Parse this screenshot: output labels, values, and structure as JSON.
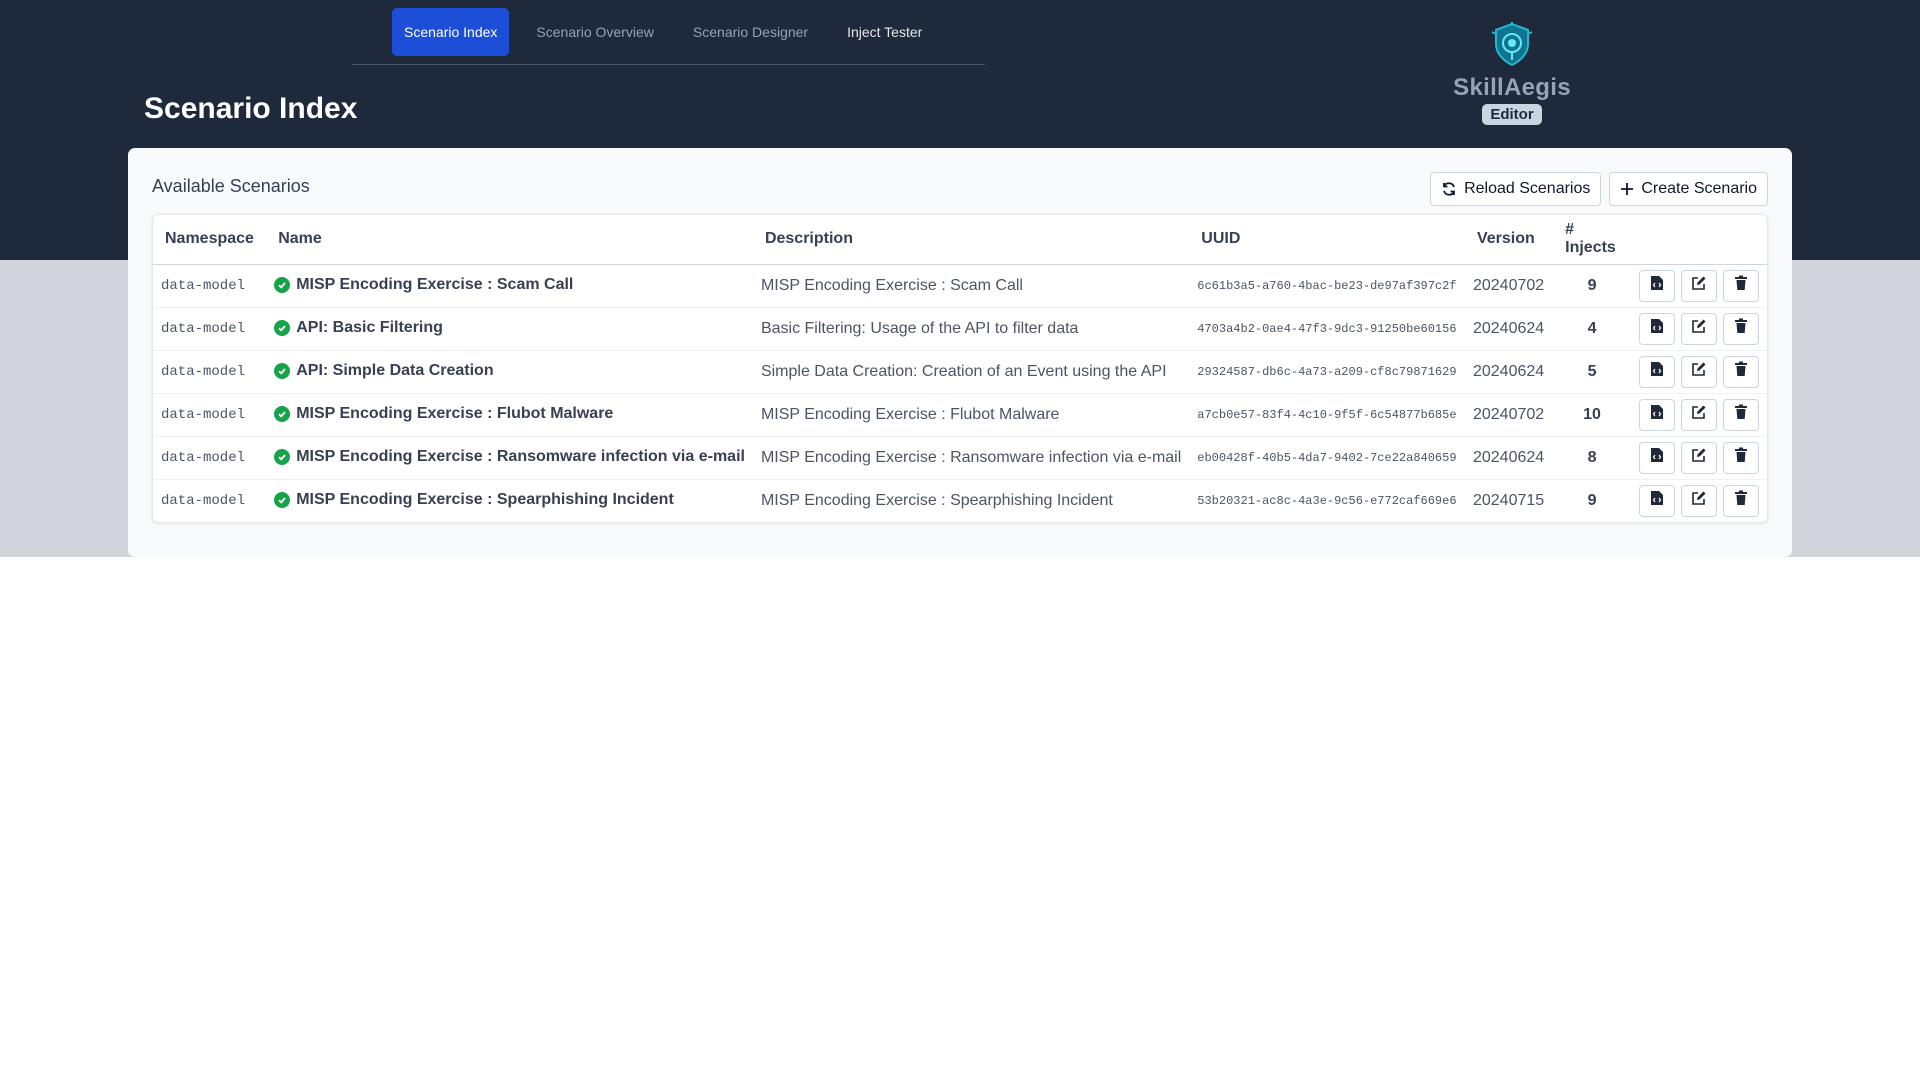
{
  "nav": {
    "tabs": [
      {
        "label": "Scenario Index",
        "active": true
      },
      {
        "label": "Scenario Overview",
        "active": false
      },
      {
        "label": "Scenario Designer",
        "active": false
      },
      {
        "label": "Inject Tester",
        "active": false
      }
    ]
  },
  "header": {
    "title": "Scenario Index"
  },
  "brand": {
    "name": "SkillAegis",
    "badge": "Editor",
    "logo_icon": "shield-eye-icon",
    "logo_color": "#22b8cf"
  },
  "card": {
    "title": "Available Scenarios",
    "reload_label": "Reload Scenarios",
    "create_label": "Create Scenario"
  },
  "table": {
    "columns": [
      "Namespace",
      "Name",
      "Description",
      "UUID",
      "Version",
      "# Injects"
    ],
    "rows": [
      {
        "namespace": "data-model",
        "name": "MISP Encoding Exercise : Scam Call",
        "description": "MISP Encoding Exercise : Scam Call",
        "uuid": "6c61b3a5-a760-4bac-be23-de97af397c2f",
        "version": "20240702",
        "injects": "9"
      },
      {
        "namespace": "data-model",
        "name": "API: Basic Filtering",
        "description": "Basic Filtering: Usage of the API to filter data",
        "uuid": "4703a4b2-0ae4-47f3-9dc3-91250be60156",
        "version": "20240624",
        "injects": "4"
      },
      {
        "namespace": "data-model",
        "name": "API: Simple Data Creation",
        "description": "Simple Data Creation: Creation of an Event using the API",
        "uuid": "29324587-db6c-4a73-a209-cf8c79871629",
        "version": "20240624",
        "injects": "5"
      },
      {
        "namespace": "data-model",
        "name": "MISP Encoding Exercise : Flubot Malware",
        "description": "MISP Encoding Exercise : Flubot Malware",
        "uuid": "a7cb0e57-83f4-4c10-9f5f-6c54877b685e",
        "version": "20240702",
        "injects": "10"
      },
      {
        "namespace": "data-model",
        "name": "MISP Encoding Exercise : Ransomware infection via e-mail",
        "description": "MISP Encoding Exercise : Ransomware infection via e-mail",
        "uuid": "eb00428f-40b5-4da7-9402-7ce22a840659",
        "version": "20240624",
        "injects": "8"
      },
      {
        "namespace": "data-model",
        "name": "MISP Encoding Exercise : Spearphishing Incident",
        "description": "MISP Encoding Exercise : Spearphishing Incident",
        "uuid": "53b20321-ac8c-4a3e-9c56-e772caf669e6",
        "version": "20240715",
        "injects": "9"
      }
    ],
    "row_status_icon": "check-circle-icon",
    "row_actions": [
      "export-file-icon",
      "edit-icon",
      "trash-icon"
    ]
  },
  "colors": {
    "header_bg": "#1e293b",
    "accent": "#1d4ed8",
    "success": "#16a34a"
  }
}
